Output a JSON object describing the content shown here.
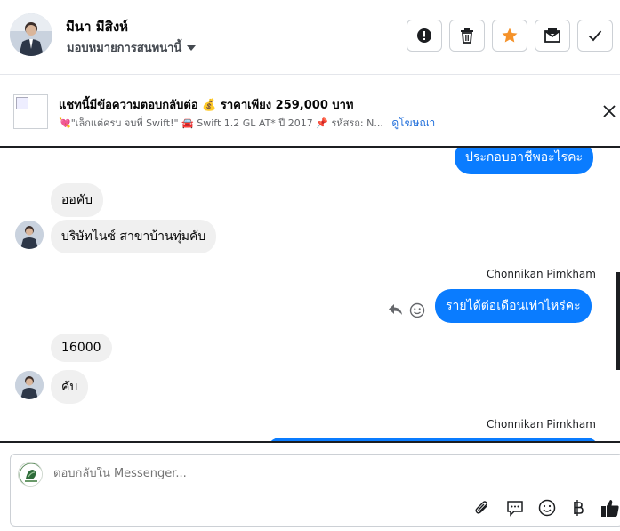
{
  "header": {
    "contact_name": "มีนา มีสิงห์",
    "assign_label": "มอบหมายการสนทนานี้",
    "actions": [
      "spam-alert",
      "delete",
      "star",
      "mark-unread",
      "done"
    ]
  },
  "ad": {
    "title": "แชทนี้มีข้อความตอบกลับต่อ 💰 ราคาเพียง 259,000 บาท",
    "subtitle": "💘\"เล็กแต่ครบ จบที่ Swift!\" 🚘 Swift 1.2 GL AT* ปี 2017 📌 รหัสรถ: N...",
    "link_label": "ดูโฆษณา"
  },
  "messages": {
    "m1": "ประกอบอาชีพอะไรคะ",
    "m2": "ออคับ",
    "m3": "บริษัทไนซ์ สาขาบ้านทุ่มคับ",
    "sender1": "Chonnikan Pimkham",
    "m4": "รายได้ต่อเดือนเท่าไหร่คะ",
    "m5": "16000",
    "m6": "คับ",
    "sender2": "Chonnikan Pimkham"
  },
  "composer": {
    "placeholder": "ตอบกลับใน Messenger..."
  },
  "colors": {
    "messenger_blue": "#0a7cff",
    "star_orange": "#f5922a",
    "link_blue": "#216fdb"
  }
}
